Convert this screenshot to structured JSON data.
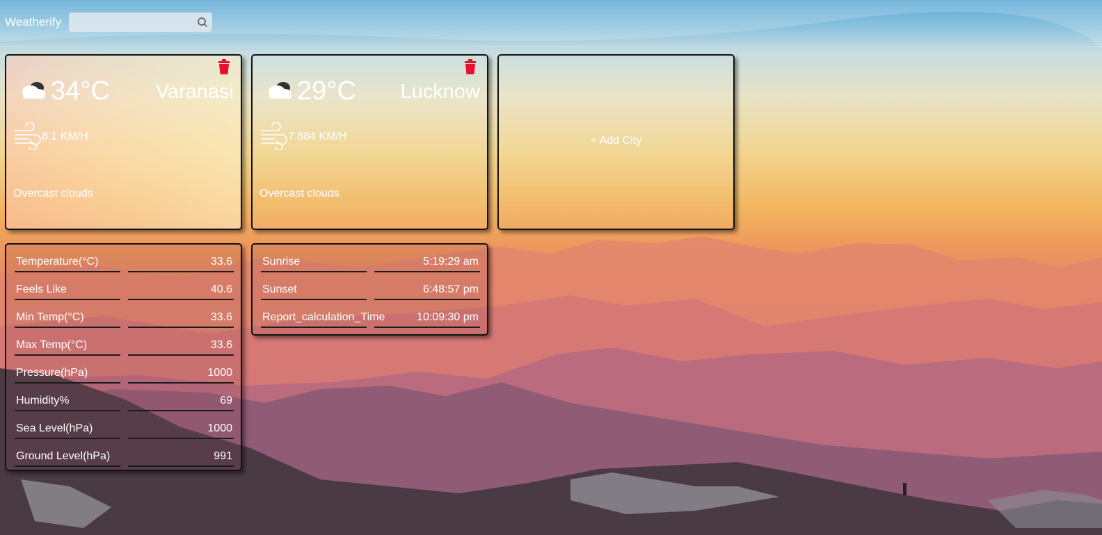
{
  "app": {
    "brand": "Weatherify"
  },
  "search": {
    "value": "",
    "placeholder": ""
  },
  "cards": [
    {
      "temp": "34°C",
      "city": "Varanasi",
      "wind": "8.1 KM/H",
      "description": "Overcast clouds",
      "icons": [
        "cloud-icon",
        "wind-icon",
        "trash-icon"
      ]
    },
    {
      "temp": "29°C",
      "city": "Lucknow",
      "wind": "7.884 KM/H",
      "description": "Overcast clouds",
      "icons": [
        "cloud-icon",
        "wind-icon",
        "trash-icon"
      ]
    }
  ],
  "add_city": {
    "label": "+ Add City"
  },
  "details": {
    "rows": [
      {
        "key": "Temperature(°C)",
        "value": "33.6"
      },
      {
        "key": "Feels Like",
        "value": "40.6"
      },
      {
        "key": "Min Temp(°C)",
        "value": "33.6"
      },
      {
        "key": "Max Temp(°C)",
        "value": "33.6"
      },
      {
        "key": "Pressure(hPa)",
        "value": "1000"
      },
      {
        "key": "Humidity%",
        "value": "69"
      },
      {
        "key": "Sea Level(hPa)",
        "value": "1000"
      },
      {
        "key": "Ground Level(hPa)",
        "value": "991"
      }
    ]
  },
  "times": {
    "rows": [
      {
        "key": "Sunrise",
        "value": "5:19:29 am"
      },
      {
        "key": "Sunset",
        "value": "6:48:57 pm"
      },
      {
        "key": "Report_calculation_Time",
        "value": "10:09:30 pm"
      }
    ]
  },
  "colors": {
    "trash": "#e8112d",
    "border": "#111111",
    "text": "#ffffff"
  }
}
